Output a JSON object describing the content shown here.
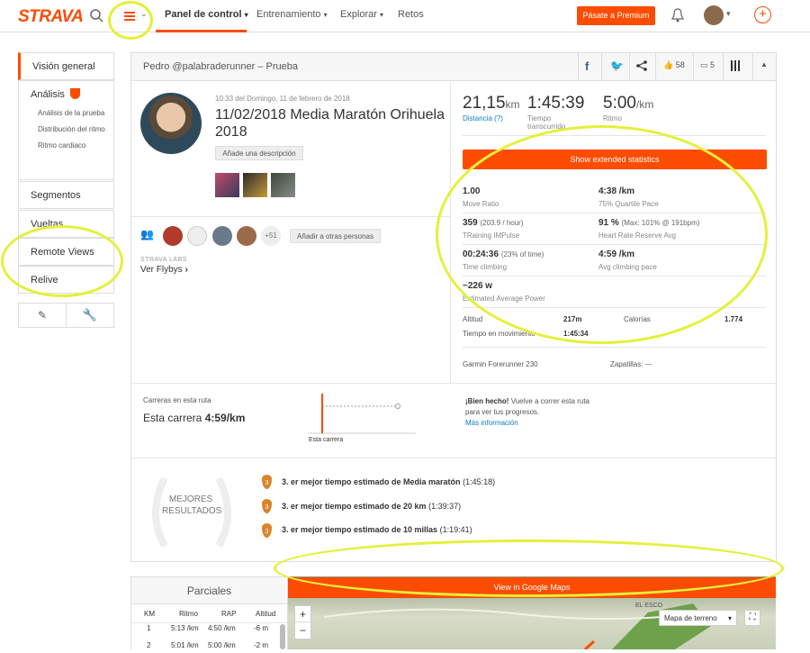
{
  "nav": {
    "logo": "STRAVA",
    "dashboard": "Panel de control",
    "training": "Entrenamiento",
    "explore": "Explorar",
    "challenges": "Retos",
    "premium": "Pásate a Premium"
  },
  "sidebar": {
    "overview": "Visión general",
    "analysis": "Análisis",
    "sub1": "Análisis de la prueba",
    "sub2": "Distribución del ritmo",
    "sub3": "Ritmo cardiaco",
    "segments": "Segmentos",
    "laps": "Vueltas",
    "remote": "Remote Views",
    "relive": "Relive"
  },
  "header": {
    "title": "Pedro @palabraderunner – Prueba",
    "kudos": "58",
    "comments": "5"
  },
  "activity": {
    "datetime": "10:33 del Domingo, 11 de febrero de 2018",
    "name": "11/02/2018 Media Maratón Orihuela 2018",
    "add_desc": "Añade una descripción",
    "more_people": "+51",
    "add_others": "Añadir a otras personas",
    "labs": "STRAVA LABS",
    "flyby": "Ver Flybys"
  },
  "stats": {
    "distance": "21,15",
    "distance_unit": "km",
    "distance_label": "Distancia",
    "distance_help": "(?)",
    "time": "1:45:39",
    "time_label": "Tiempo transcurrido",
    "pace": "5:00",
    "pace_unit": "/km",
    "pace_label": "Ritmo",
    "ext_btn": "Show extended statistics",
    "m1_val": "1.00",
    "m1_label": "Move Ratio",
    "m2_val": "4:38 /km",
    "m2_label": "75% Quartile Pace",
    "m3_val": "359",
    "m3_extra": "(203.9 / hour)",
    "m3_label": "TRaining IMPulse",
    "m4_val": "91 %",
    "m4_extra": "(Max: 101% @ 191bpm)",
    "m4_label": "Heart Rate Reserve Avg",
    "m5_val": "00:24:36",
    "m5_extra": "(23% of time)",
    "m5_label": "Time climbing",
    "m6_val": "4:59 /km",
    "m6_label": "Avg climbing pace",
    "m7_val": "~226 w",
    "m7_label": "Estimated Average Power",
    "alt_label": "Altitud",
    "alt_val": "217m",
    "cal_label": "Calorías",
    "cal_val": "1.774",
    "move_label": "Tiempo en movimiento",
    "move_val": "1:45:34",
    "device": "Garmin Forerunner 230",
    "shoes": "Zapatillas: —"
  },
  "route": {
    "label": "Carreras en esta ruta",
    "this_run": "Esta carrera",
    "this_pace": "4:59/km",
    "chart_label": "Esta carrera",
    "well_done": "¡Bien hecho!",
    "msg": "Vuelve a correr esta ruta para ver tus progresos.",
    "more": "Más información"
  },
  "best": {
    "badge_line1": "MEJORES",
    "badge_line2": "RESULTADOS",
    "r1": "3. er mejor tiempo estimado de Media maratón",
    "r1_time": "(1:45:18)",
    "r2": "3. er mejor tiempo estimado de 20 km",
    "r2_time": "(1:39:37)",
    "r3": "3. er mejor tiempo estimado de 10 millas",
    "r3_time": "(1:19:41)",
    "medal_num": "3"
  },
  "splits": {
    "title": "Parciales",
    "headers": [
      "KM",
      "Ritmo",
      "RAP",
      "Altitud"
    ],
    "rows": [
      [
        "1",
        "5:13 /km",
        "4:50 /km",
        "-6 m"
      ],
      [
        "2",
        "5:01 /km",
        "5:00 /km",
        "-2 m"
      ]
    ]
  },
  "map": {
    "gmaps_btn": "View in Google Maps",
    "terrain": "Mapa de terreno",
    "zoom_in": "+",
    "zoom_out": "−",
    "place": "EL ESCO"
  },
  "colors": {
    "brand": "#fc4c02",
    "highlight": "#e4f03a"
  }
}
